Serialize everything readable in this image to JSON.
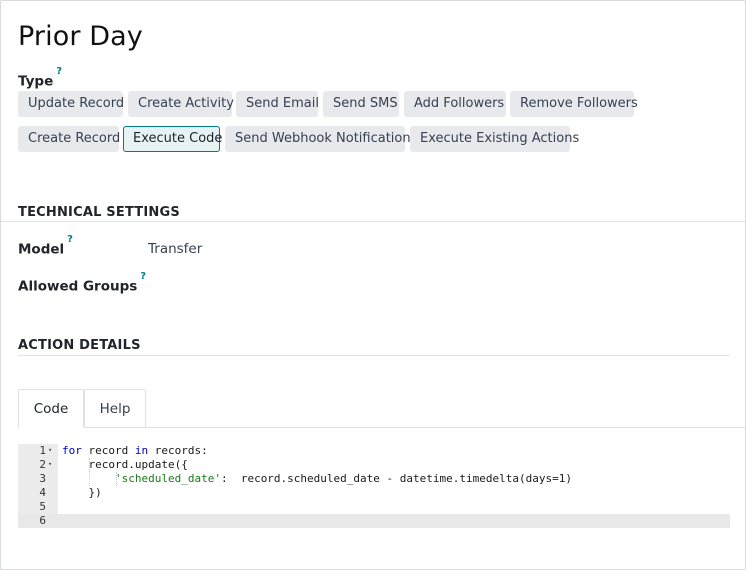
{
  "page": {
    "title": "Prior Day"
  },
  "type_field": {
    "label": "Type",
    "help": "?",
    "options": [
      "Update Record",
      "Create Activity",
      "Send Email",
      "Send SMS",
      "Add Followers",
      "Remove Followers",
      "Create Record",
      "Execute Code",
      "Send Webhook Notification",
      "Execute Existing Actions"
    ],
    "selected": "Execute Code"
  },
  "technical": {
    "title": "TECHNICAL SETTINGS",
    "model_label": "Model",
    "model_help": "?",
    "model_value": "Transfer",
    "groups_label": "Allowed Groups",
    "groups_help": "?"
  },
  "action_details": {
    "title": "ACTION DETAILS",
    "tabs": [
      "Code",
      "Help"
    ],
    "active_tab": "Code"
  },
  "code": {
    "lines": [
      {
        "n": "1",
        "fold": "▾",
        "text": "for record in records:"
      },
      {
        "n": "2",
        "fold": "▾",
        "text": "    record.update({"
      },
      {
        "n": "3",
        "fold": "",
        "text": "        'scheduled_date':  record.scheduled_date - datetime.timedelta(days=1)"
      },
      {
        "n": "4",
        "fold": "",
        "text": "    })"
      },
      {
        "n": "5",
        "fold": "",
        "text": ""
      },
      {
        "n": "6",
        "fold": "",
        "text": ""
      }
    ],
    "current_line": "6"
  },
  "colors": {
    "accent": "#017e84",
    "button_bg": "#e7e9ed",
    "keyword": "#0000cc",
    "string": "#1a7a1a"
  }
}
